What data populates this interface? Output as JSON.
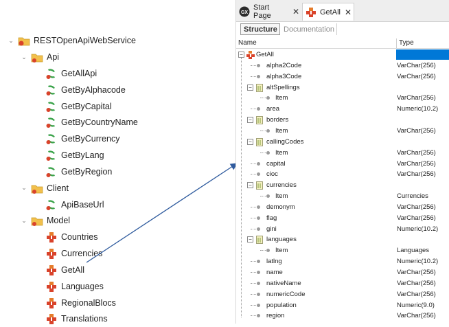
{
  "left_tree": {
    "root": {
      "label": "RESTOpenApiWebService",
      "icon": "folder-web-icon"
    },
    "folders": [
      {
        "label": "Api",
        "icon": "folder-icon",
        "items": [
          "GetAllApi",
          "GetByAlphacode",
          "GetByCapital",
          "GetByCountryName",
          "GetByCurrency",
          "GetByLang",
          "GetByRegion"
        ],
        "item_icon": "procedure-icon"
      },
      {
        "label": "Client",
        "icon": "folder-icon",
        "items": [
          "ApiBaseUrl"
        ],
        "item_icon": "procedure-icon"
      },
      {
        "label": "Model",
        "icon": "folder-icon",
        "items": [
          "Countries",
          "Currencies",
          "GetAll",
          "Languages",
          "RegionalBlocs",
          "Translations"
        ],
        "item_icon": "sdt-icon"
      }
    ]
  },
  "editor": {
    "tabs": [
      {
        "label": "Start Page",
        "icon": "genexus-logo-icon",
        "close": "✕"
      },
      {
        "label": "GetAll",
        "icon": "sdt-icon",
        "close": "✕",
        "active": true
      }
    ],
    "subtabs": [
      {
        "label": "Structure",
        "active": true
      },
      {
        "label": "Documentation",
        "active": false
      }
    ],
    "columns": {
      "name": "Name",
      "type": "Type"
    },
    "rows": [
      {
        "name": "GetAll",
        "type": "",
        "level": 0,
        "kind": "root"
      },
      {
        "name": "alpha2Code",
        "type": "VarChar(256)",
        "level": 1,
        "kind": "item"
      },
      {
        "name": "alpha3Code",
        "type": "VarChar(256)",
        "level": 1,
        "kind": "item"
      },
      {
        "name": "altSpellings",
        "type": "",
        "level": 1,
        "kind": "collection"
      },
      {
        "name": "Item",
        "type": "VarChar(256)",
        "level": 2,
        "kind": "item"
      },
      {
        "name": "area",
        "type": "Numeric(10.2)",
        "level": 1,
        "kind": "item"
      },
      {
        "name": "borders",
        "type": "",
        "level": 1,
        "kind": "collection"
      },
      {
        "name": "Item",
        "type": "VarChar(256)",
        "level": 2,
        "kind": "item"
      },
      {
        "name": "callingCodes",
        "type": "",
        "level": 1,
        "kind": "collection"
      },
      {
        "name": "Item",
        "type": "VarChar(256)",
        "level": 2,
        "kind": "item"
      },
      {
        "name": "capital",
        "type": "VarChar(256)",
        "level": 1,
        "kind": "item"
      },
      {
        "name": "cioc",
        "type": "VarChar(256)",
        "level": 1,
        "kind": "item"
      },
      {
        "name": "currencies",
        "type": "",
        "level": 1,
        "kind": "collection"
      },
      {
        "name": "Item",
        "type": "Currencies",
        "level": 2,
        "kind": "item"
      },
      {
        "name": "demonym",
        "type": "VarChar(256)",
        "level": 1,
        "kind": "item"
      },
      {
        "name": "flag",
        "type": "VarChar(256)",
        "level": 1,
        "kind": "item"
      },
      {
        "name": "gini",
        "type": "Numeric(10.2)",
        "level": 1,
        "kind": "item"
      },
      {
        "name": "languages",
        "type": "",
        "level": 1,
        "kind": "collection"
      },
      {
        "name": "Item",
        "type": "Languages",
        "level": 2,
        "kind": "item"
      },
      {
        "name": "latlng",
        "type": "Numeric(10.2)",
        "level": 1,
        "kind": "item"
      },
      {
        "name": "name",
        "type": "VarChar(256)",
        "level": 1,
        "kind": "item"
      },
      {
        "name": "nativeName",
        "type": "VarChar(256)",
        "level": 1,
        "kind": "item"
      },
      {
        "name": "numericCode",
        "type": "VarChar(256)",
        "level": 1,
        "kind": "item"
      },
      {
        "name": "population",
        "type": "Numeric(9.0)",
        "level": 1,
        "kind": "item"
      },
      {
        "name": "region",
        "type": "VarChar(256)",
        "level": 1,
        "kind": "item"
      }
    ]
  },
  "colors": {
    "selection": "#0078d7",
    "arrow": "#2f5b9e",
    "folder": "#f2c04c",
    "sdt_red": "#d9432b",
    "proc_green": "#3aa34a"
  }
}
